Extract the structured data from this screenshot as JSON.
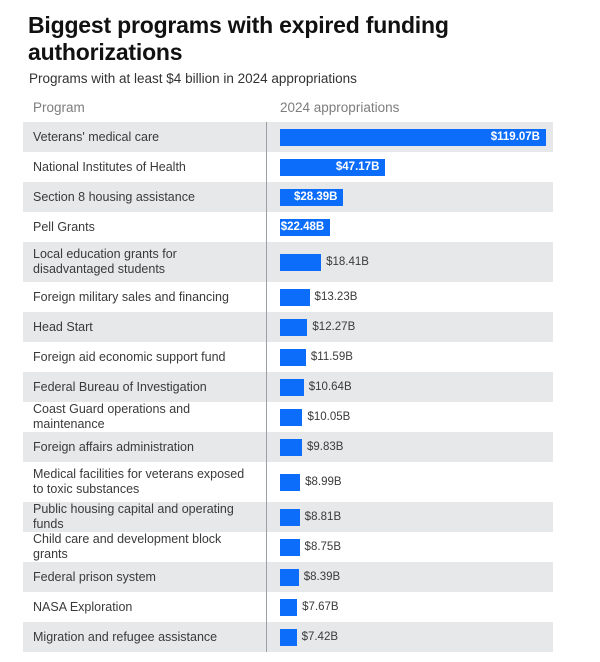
{
  "header": {
    "title": "Biggest programs with expired funding authorizations",
    "subtitle": "Programs with at least $4 billion in 2024 appropriations"
  },
  "columns": {
    "program": "Program",
    "appropriations": "2024 appropriations"
  },
  "colors": {
    "bar": "#0c6dfa",
    "row_alt": "#e6e8ea",
    "row_default": "#ffffff",
    "divider": "#9aa0a6",
    "header_text": "#7d7d7d"
  },
  "chart_data": {
    "type": "bar",
    "title": "Biggest programs with expired funding authorizations",
    "subtitle": "Programs with at least $4 billion in 2024 appropriations",
    "xlabel": "2024 appropriations",
    "ylabel": "Program",
    "unit": "billions of US dollars",
    "orientation": "horizontal",
    "grid": false,
    "legend": false,
    "xlim": [
      0,
      119.07
    ],
    "categories": [
      "Veterans' medical care",
      "National Institutes of Health",
      "Section 8 housing assistance",
      "Pell Grants",
      "Local education grants for disadvantaged students",
      "Foreign military sales and financing",
      "Head Start",
      "Foreign aid economic support fund",
      "Federal Bureau of Investigation",
      "Coast Guard operations and maintenance",
      "Foreign affairs administration",
      "Medical facilities for veterans exposed to toxic substances",
      "Public housing capital and operating funds",
      "Child care and development block grants",
      "Federal prison system",
      "NASA Exploration",
      "Migration and refugee assistance"
    ],
    "values": [
      119.07,
      47.17,
      28.39,
      22.48,
      18.41,
      13.23,
      12.27,
      11.59,
      10.64,
      10.05,
      9.83,
      8.99,
      8.81,
      8.75,
      8.39,
      7.67,
      7.42
    ],
    "value_labels": [
      "$119.07B",
      "$47.17B",
      "$28.39B",
      "$22.48B",
      "$18.41B",
      "$13.23B",
      "$12.27B",
      "$11.59B",
      "$10.64B",
      "$10.05B",
      "$9.83B",
      "$8.99B",
      "$8.81B",
      "$8.75B",
      "$8.39B",
      "$7.67B",
      "$7.42B"
    ]
  },
  "rows": [
    {
      "program": "Veterans' medical care",
      "value": 119.07,
      "value_label": "$119.07B",
      "label_inside": true,
      "tall": false,
      "alt": true
    },
    {
      "program": "National Institutes of Health",
      "value": 47.17,
      "value_label": "$47.17B",
      "label_inside": true,
      "tall": false,
      "alt": false
    },
    {
      "program": "Section 8 housing assistance",
      "value": 28.39,
      "value_label": "$28.39B",
      "label_inside": true,
      "tall": false,
      "alt": true
    },
    {
      "program": "Pell Grants",
      "value": 22.48,
      "value_label": "$22.48B",
      "label_inside": true,
      "tall": false,
      "alt": false
    },
    {
      "program": "Local education grants for disadvantaged students",
      "value": 18.41,
      "value_label": "$18.41B",
      "label_inside": false,
      "tall": true,
      "alt": true
    },
    {
      "program": "Foreign military sales and financing",
      "value": 13.23,
      "value_label": "$13.23B",
      "label_inside": false,
      "tall": false,
      "alt": false
    },
    {
      "program": "Head Start",
      "value": 12.27,
      "value_label": "$12.27B",
      "label_inside": false,
      "tall": false,
      "alt": true
    },
    {
      "program": "Foreign aid economic support fund",
      "value": 11.59,
      "value_label": "$11.59B",
      "label_inside": false,
      "tall": false,
      "alt": false
    },
    {
      "program": "Federal Bureau of Investigation",
      "value": 10.64,
      "value_label": "$10.64B",
      "label_inside": false,
      "tall": false,
      "alt": true
    },
    {
      "program": "Coast Guard operations and maintenance",
      "value": 10.05,
      "value_label": "$10.05B",
      "label_inside": false,
      "tall": false,
      "alt": false
    },
    {
      "program": "Foreign affairs administration",
      "value": 9.83,
      "value_label": "$9.83B",
      "label_inside": false,
      "tall": false,
      "alt": true
    },
    {
      "program": "Medical facilities for veterans exposed to toxic substances",
      "value": 8.99,
      "value_label": "$8.99B",
      "label_inside": false,
      "tall": true,
      "alt": false
    },
    {
      "program": "Public housing capital and operating funds",
      "value": 8.81,
      "value_label": "$8.81B",
      "label_inside": false,
      "tall": false,
      "alt": true
    },
    {
      "program": "Child care and development block grants",
      "value": 8.75,
      "value_label": "$8.75B",
      "label_inside": false,
      "tall": false,
      "alt": false
    },
    {
      "program": "Federal prison system",
      "value": 8.39,
      "value_label": "$8.39B",
      "label_inside": false,
      "tall": false,
      "alt": true
    },
    {
      "program": "NASA Exploration",
      "value": 7.67,
      "value_label": "$7.67B",
      "label_inside": false,
      "tall": false,
      "alt": false
    },
    {
      "program": "Migration and refugee assistance",
      "value": 7.42,
      "value_label": "$7.42B",
      "label_inside": false,
      "tall": false,
      "alt": true
    }
  ]
}
